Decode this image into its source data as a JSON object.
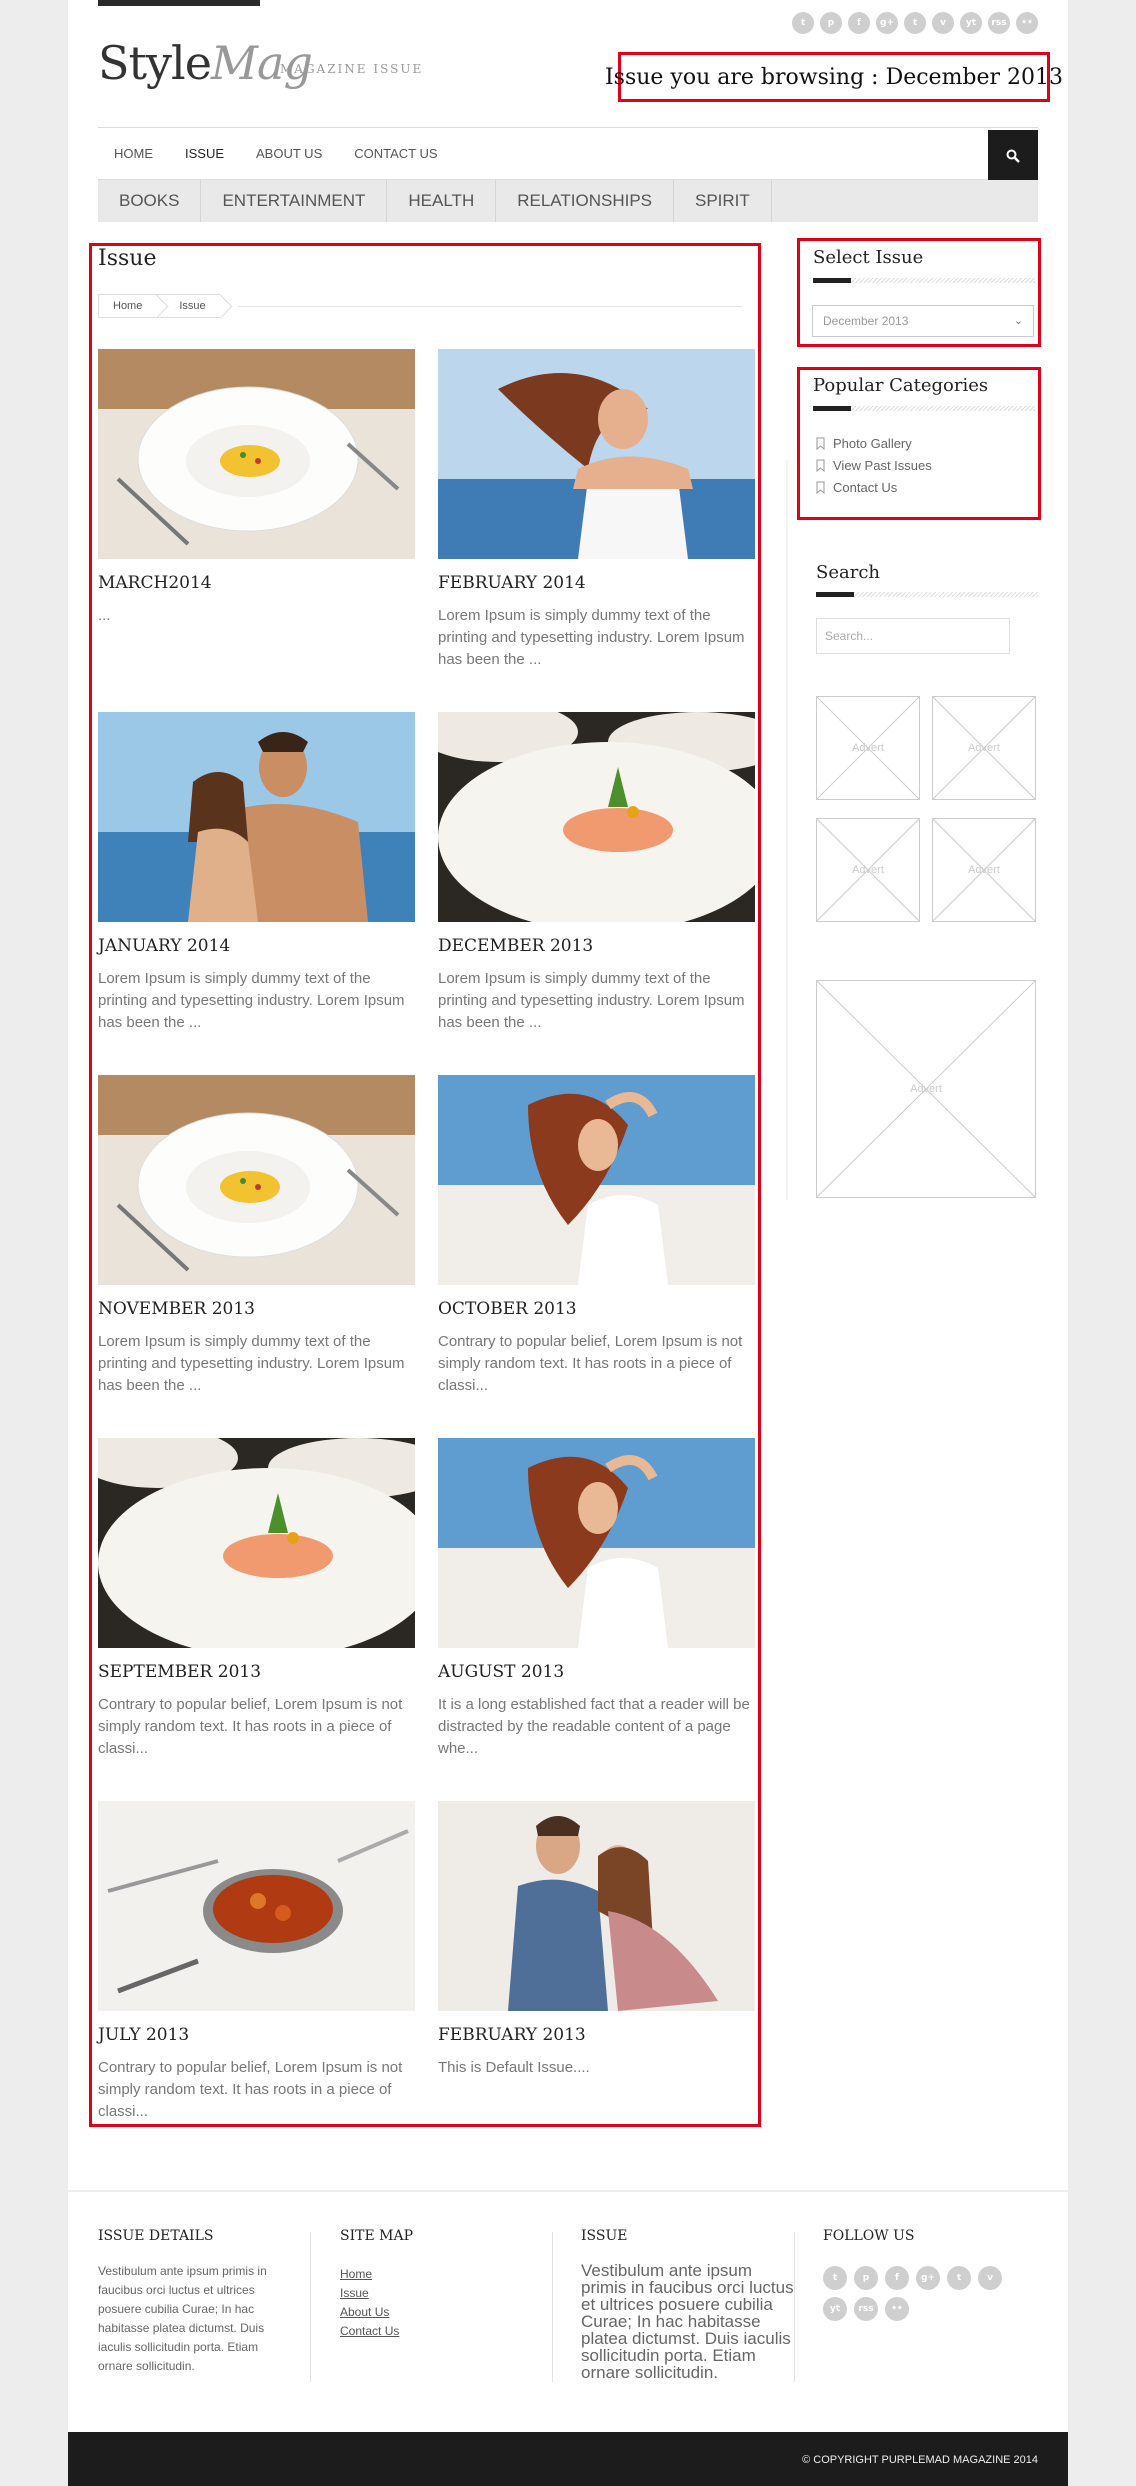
{
  "header": {
    "logo_style": "Style",
    "logo_mag": "Mag",
    "tagline": "MAGAZINE ISSUE",
    "browsing_text": "Issue you are browsing : December 2013",
    "social_icons": [
      "twitter-icon",
      "pinterest-icon",
      "facebook-icon",
      "googleplus-icon",
      "tumblr-icon",
      "vimeo-icon",
      "youtube-icon",
      "rss-icon",
      "flickr-icon"
    ],
    "social_glyphs": [
      "t",
      "p",
      "f",
      "g+",
      "t",
      "v",
      "yt",
      "rss",
      "••"
    ]
  },
  "nav": {
    "items": [
      "HOME",
      "ISSUE",
      "ABOUT US",
      "CONTACT US"
    ],
    "active": "ISSUE"
  },
  "categories": [
    "BOOKS",
    "ENTERTAINMENT",
    "HEALTH",
    "RELATIONSHIPS",
    "SPIRIT"
  ],
  "main": {
    "title": "Issue",
    "breadcrumb": [
      "Home",
      "Issue"
    ],
    "cards": [
      {
        "title": "MARCH2014",
        "text": "...",
        "image": "food-plate-image"
      },
      {
        "title": "FEBRUARY 2014",
        "text": "Lorem Ipsum is simply dummy text of the printing and typesetting industry. Lorem Ipsum has been the ...",
        "image": "woman-beach-image"
      },
      {
        "title": "JANUARY 2014",
        "text": "Lorem Ipsum is simply dummy text of the printing and typesetting industry. Lorem Ipsum has been the ...",
        "image": "couple-beach-image"
      },
      {
        "title": "DECEMBER 2013",
        "text": "Lorem Ipsum is simply dummy text of the printing and typesetting industry. Lorem Ipsum has been the ...",
        "image": "salmon-plate-image"
      },
      {
        "title": "NOVEMBER 2013",
        "text": "Lorem Ipsum is simply dummy text of the printing and typesetting industry. Lorem Ipsum has been the ...",
        "image": "food-plate-image"
      },
      {
        "title": "OCTOBER 2013",
        "text": "Contrary to popular belief, Lorem Ipsum is not simply random text. It has roots in a piece of classi...",
        "image": "woman-redhair-image"
      },
      {
        "title": "SEPTEMBER 2013",
        "text": "Contrary to popular belief, Lorem Ipsum is not simply random text. It has roots in a piece of classi...",
        "image": "salmon-plate-image"
      },
      {
        "title": "AUGUST 2013",
        "text": "It is a long established fact that a reader will be distracted by the readable content of a page whe...",
        "image": "woman-redhair-image"
      },
      {
        "title": "JULY 2013",
        "text": "Contrary to popular belief, Lorem Ipsum is not simply random text. It has roots in a piece of classi...",
        "image": "curry-dish-image"
      },
      {
        "title": "FEBRUARY 2013",
        "text": "This is Default Issue....",
        "image": "couple-sitting-image"
      }
    ]
  },
  "sidebar": {
    "select_issue": {
      "title": "Select Issue",
      "selected": "December 2013"
    },
    "popular": {
      "title": "Popular Categories",
      "items": [
        "Photo Gallery",
        "View Past Issues",
        "Contact Us"
      ]
    },
    "search": {
      "title": "Search",
      "placeholder": "Search..."
    },
    "advert_label": "Advert"
  },
  "footer": {
    "issue_details": {
      "title": "ISSUE DETAILS",
      "text": "Vestibulum ante ipsum primis in faucibus orci luctus et ultrices posuere cubilia Curae; In hac habitasse platea dictumst. Duis iaculis sollicitudin porta. Etiam ornare sollicitudin."
    },
    "site_map": {
      "title": "SITE MAP",
      "links": [
        "Home",
        "Issue",
        "About Us",
        "Contact Us"
      ]
    },
    "issue": {
      "title": "ISSUE",
      "text": "Vestibulum ante ipsum primis in faucibus orci luctus et ultrices posuere cubilia Curae; In hac habitasse platea dictumst. Duis iaculis sollicitudin porta. Etiam ornare sollicitudin."
    },
    "follow": {
      "title": "FOLLOW US",
      "icons": [
        "twitter-icon",
        "pinterest-icon",
        "facebook-icon",
        "googleplus-icon",
        "tumblr-icon",
        "vimeo-icon",
        "youtube-icon",
        "rss-icon",
        "flickr-icon"
      ],
      "glyphs": [
        "t",
        "p",
        "f",
        "g+",
        "t",
        "v",
        "yt",
        "rss",
        "••"
      ]
    },
    "copyright": "© COPYRIGHT PURPLEMAD MAGAZINE 2014"
  },
  "colors": {
    "highlight": "#e0001a",
    "dark": "#1c1c1c",
    "page_bg": "#ededed"
  }
}
